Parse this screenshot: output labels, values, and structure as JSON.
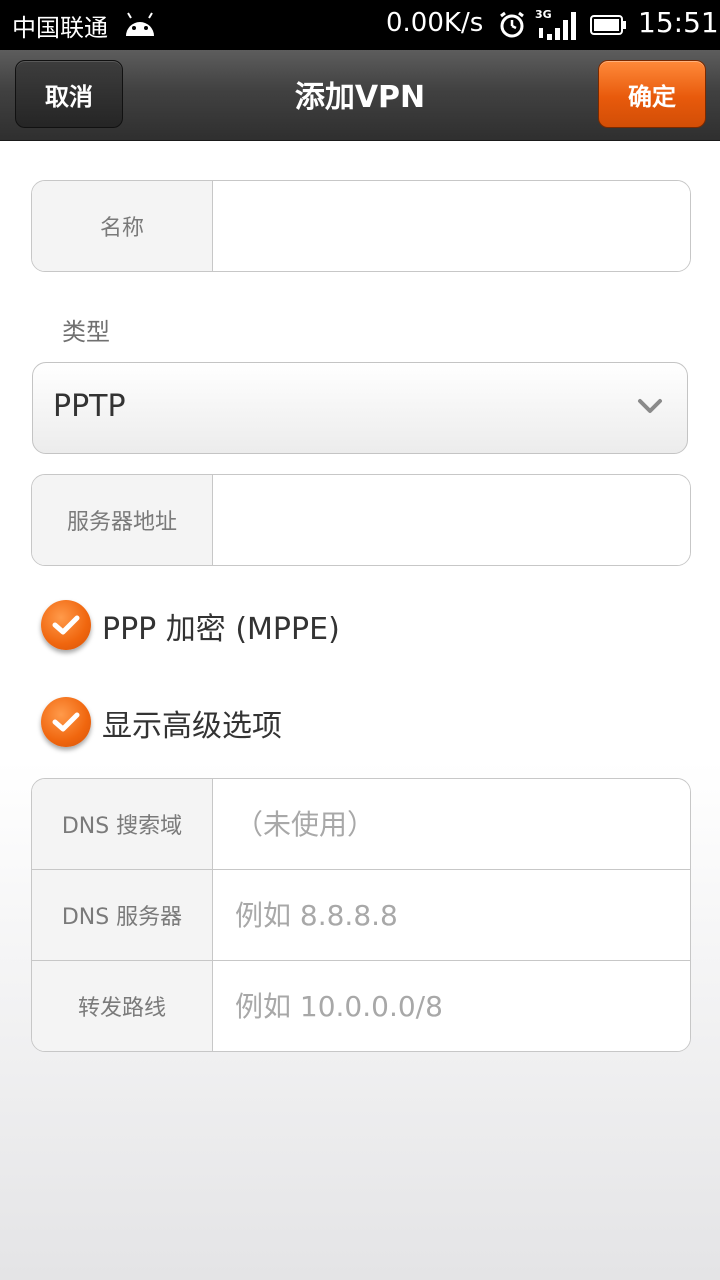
{
  "status_bar": {
    "carrier": "中国联通",
    "net_speed": "0.00K/s",
    "network_type": "3G",
    "time": "15:51"
  },
  "title_bar": {
    "cancel_label": "取消",
    "title": "添加VPN",
    "confirm_label": "确定"
  },
  "form": {
    "name": {
      "label": "名称",
      "value": ""
    },
    "type": {
      "label": "类型",
      "selected": "PPTP"
    },
    "server": {
      "label": "服务器地址",
      "value": ""
    },
    "ppp_encryption": {
      "label": "PPP 加密 (MPPE)",
      "checked": true
    },
    "show_advanced": {
      "label": "显示高级选项",
      "checked": true
    },
    "advanced": {
      "dns_search": {
        "label": "DNS 搜索域",
        "placeholder": "（未使用）"
      },
      "dns_servers": {
        "label": "DNS 服务器",
        "placeholder": "例如 8.8.8.8"
      },
      "routes": {
        "label": "转发路线",
        "placeholder": "例如 10.0.0.0/8"
      }
    }
  },
  "colors": {
    "accent": "#e85a0c",
    "title_bar": "#3a3a3a"
  }
}
